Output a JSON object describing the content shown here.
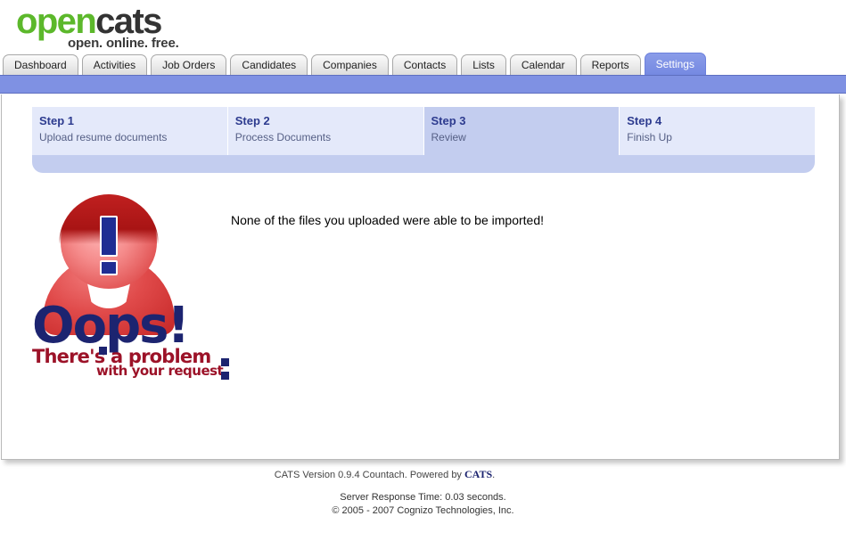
{
  "logo": {
    "word_open": "open",
    "word_cats": "cats",
    "tagline": "open. online. free."
  },
  "tabs": [
    {
      "label": "Dashboard",
      "active": false
    },
    {
      "label": "Activities",
      "active": false
    },
    {
      "label": "Job Orders",
      "active": false
    },
    {
      "label": "Candidates",
      "active": false
    },
    {
      "label": "Companies",
      "active": false
    },
    {
      "label": "Contacts",
      "active": false
    },
    {
      "label": "Lists",
      "active": false
    },
    {
      "label": "Calendar",
      "active": false
    },
    {
      "label": "Reports",
      "active": false
    },
    {
      "label": "Settings",
      "active": true
    }
  ],
  "wizard": {
    "steps": [
      {
        "title": "Step 1",
        "subtitle": "Upload resume documents",
        "active": false
      },
      {
        "title": "Step 2",
        "subtitle": "Process Documents",
        "active": false
      },
      {
        "title": "Step 3",
        "subtitle": "Review",
        "active": true
      },
      {
        "title": "Step 4",
        "subtitle": "Finish Up",
        "active": false
      }
    ]
  },
  "main": {
    "import_message": "None of the files you uploaded were able to be imported!",
    "error_graphic": {
      "headline": "Oops!",
      "line1": "There's a problem",
      "line2": "with your request",
      "icon": "error-person-exclamation-icon"
    }
  },
  "footer": {
    "version_prefix": "CATS Version 0.9.4 Countach. Powered by ",
    "brand": "CATS",
    "version_suffix": ".",
    "response_time": "Server Response Time: 0.03 seconds.",
    "copyright": "© 2005 - 2007 Cognizo Technologies, Inc."
  },
  "colors": {
    "accent_blue": "#7f91e3",
    "logo_green": "#5cb82b",
    "step_active": "#c3cdef",
    "step_inactive": "#e4e9fa",
    "error_red": "#9c1228",
    "error_navy": "#1c2470"
  }
}
